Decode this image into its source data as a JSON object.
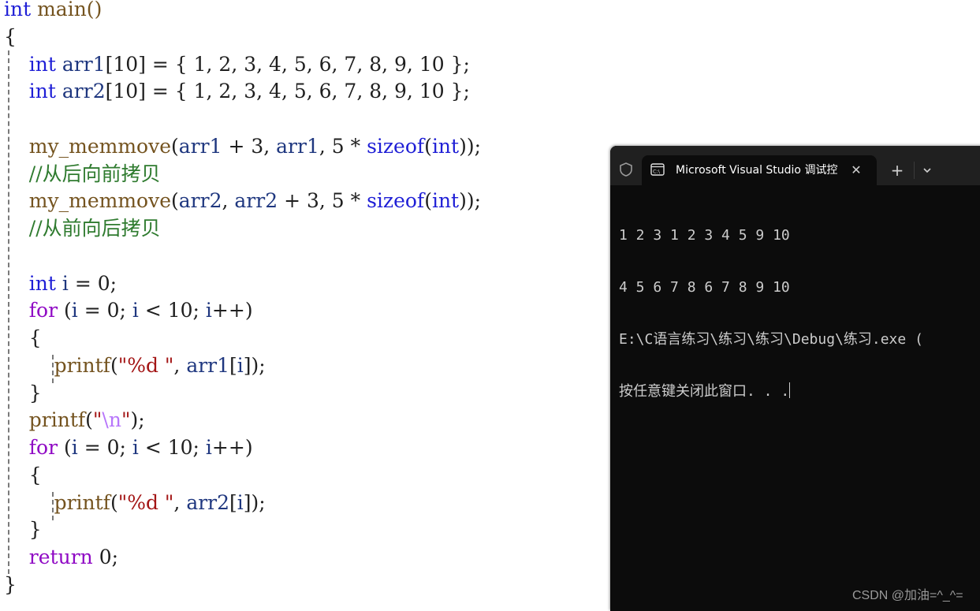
{
  "code": {
    "lines": [
      {
        "tokens": [
          {
            "t": "int",
            "c": "kw"
          },
          {
            "t": " main()",
            "c": "fn"
          }
        ]
      },
      {
        "tokens": [
          {
            "t": "{",
            "c": "punc"
          }
        ]
      },
      {
        "tokens": [
          {
            "t": "    "
          },
          {
            "t": "int",
            "c": "kw"
          },
          {
            "t": " arr1",
            "c": "var"
          },
          {
            "t": "[10] = { 1, 2, 3, 4, 5, 6, 7, 8, 9, 10 };",
            "c": "punc"
          }
        ]
      },
      {
        "tokens": [
          {
            "t": "    "
          },
          {
            "t": "int",
            "c": "kw"
          },
          {
            "t": " arr2",
            "c": "var"
          },
          {
            "t": "[10] = { 1, 2, 3, 4, 5, 6, 7, 8, 9, 10 };",
            "c": "punc"
          }
        ]
      },
      {
        "tokens": []
      },
      {
        "tokens": [
          {
            "t": "    "
          },
          {
            "t": "my_memmove",
            "c": "fn"
          },
          {
            "t": "(",
            "c": "punc"
          },
          {
            "t": "arr1",
            "c": "var"
          },
          {
            "t": " + 3, ",
            "c": "punc"
          },
          {
            "t": "arr1",
            "c": "var"
          },
          {
            "t": ", 5 * ",
            "c": "punc"
          },
          {
            "t": "sizeof",
            "c": "kw"
          },
          {
            "t": "(",
            "c": "punc"
          },
          {
            "t": "int",
            "c": "kw"
          },
          {
            "t": "));",
            "c": "punc"
          }
        ]
      },
      {
        "tokens": [
          {
            "t": "    "
          },
          {
            "t": "//从后向前拷贝",
            "c": "cmt"
          }
        ]
      },
      {
        "tokens": [
          {
            "t": "    "
          },
          {
            "t": "my_memmove",
            "c": "fn"
          },
          {
            "t": "(",
            "c": "punc"
          },
          {
            "t": "arr2",
            "c": "var"
          },
          {
            "t": ", ",
            "c": "punc"
          },
          {
            "t": "arr2",
            "c": "var"
          },
          {
            "t": " + 3, 5 * ",
            "c": "punc"
          },
          {
            "t": "sizeof",
            "c": "kw"
          },
          {
            "t": "(",
            "c": "punc"
          },
          {
            "t": "int",
            "c": "kw"
          },
          {
            "t": "));",
            "c": "punc"
          }
        ]
      },
      {
        "tokens": [
          {
            "t": "    "
          },
          {
            "t": "//从前向后拷贝",
            "c": "cmt"
          }
        ]
      },
      {
        "tokens": []
      },
      {
        "tokens": [
          {
            "t": "    "
          },
          {
            "t": "int",
            "c": "kw"
          },
          {
            "t": " i",
            "c": "var"
          },
          {
            "t": " = 0;",
            "c": "punc"
          }
        ]
      },
      {
        "tokens": [
          {
            "t": "    "
          },
          {
            "t": "for",
            "c": "ctl"
          },
          {
            "t": " (",
            "c": "punc"
          },
          {
            "t": "i",
            "c": "var"
          },
          {
            "t": " = 0; ",
            "c": "punc"
          },
          {
            "t": "i",
            "c": "var"
          },
          {
            "t": " < 10; ",
            "c": "punc"
          },
          {
            "t": "i",
            "c": "var"
          },
          {
            "t": "++)",
            "c": "punc"
          }
        ]
      },
      {
        "tokens": [
          {
            "t": "    "
          },
          {
            "t": "{",
            "c": "punc"
          }
        ]
      },
      {
        "tokens": [
          {
            "t": "        "
          },
          {
            "t": "printf",
            "c": "fn"
          },
          {
            "t": "(",
            "c": "punc"
          },
          {
            "t": "\"%d \"",
            "c": "str"
          },
          {
            "t": ", ",
            "c": "punc"
          },
          {
            "t": "arr1",
            "c": "var"
          },
          {
            "t": "[",
            "c": "punc"
          },
          {
            "t": "i",
            "c": "var"
          },
          {
            "t": "]);",
            "c": "punc"
          }
        ]
      },
      {
        "tokens": [
          {
            "t": "    "
          },
          {
            "t": "}",
            "c": "punc"
          }
        ]
      },
      {
        "tokens": [
          {
            "t": "    "
          },
          {
            "t": "printf",
            "c": "fn"
          },
          {
            "t": "(",
            "c": "punc"
          },
          {
            "t": "\"",
            "c": "str"
          },
          {
            "t": "\\n",
            "c": "esc"
          },
          {
            "t": "\"",
            "c": "str"
          },
          {
            "t": ");",
            "c": "punc"
          }
        ]
      },
      {
        "tokens": [
          {
            "t": "    "
          },
          {
            "t": "for",
            "c": "ctl"
          },
          {
            "t": " (",
            "c": "punc"
          },
          {
            "t": "i",
            "c": "var"
          },
          {
            "t": " = 0; ",
            "c": "punc"
          },
          {
            "t": "i",
            "c": "var"
          },
          {
            "t": " < 10; ",
            "c": "punc"
          },
          {
            "t": "i",
            "c": "var"
          },
          {
            "t": "++)",
            "c": "punc"
          }
        ]
      },
      {
        "tokens": [
          {
            "t": "    "
          },
          {
            "t": "{",
            "c": "punc"
          }
        ]
      },
      {
        "tokens": [
          {
            "t": "        "
          },
          {
            "t": "printf",
            "c": "fn"
          },
          {
            "t": "(",
            "c": "punc"
          },
          {
            "t": "\"%d \"",
            "c": "str"
          },
          {
            "t": ", ",
            "c": "punc"
          },
          {
            "t": "arr2",
            "c": "var"
          },
          {
            "t": "[",
            "c": "punc"
          },
          {
            "t": "i",
            "c": "var"
          },
          {
            "t": "]);",
            "c": "punc"
          }
        ]
      },
      {
        "tokens": [
          {
            "t": "    "
          },
          {
            "t": "}",
            "c": "punc"
          }
        ]
      },
      {
        "tokens": [
          {
            "t": "    "
          },
          {
            "t": "return",
            "c": "ctl"
          },
          {
            "t": " 0;",
            "c": "punc"
          }
        ]
      },
      {
        "tokens": [
          {
            "t": "}",
            "c": "punc"
          }
        ]
      }
    ]
  },
  "terminal": {
    "tab_title": "Microsoft Visual Studio 调试控制台",
    "tab_icon": "console-icon",
    "shield_icon": "shield-icon",
    "close_glyph": "✕",
    "new_tab_glyph": "+",
    "output_lines": [
      "1 2 3 1 2 3 4 5 9 10",
      "4 5 6 7 8 6 7 8 9 10",
      "E:\\C语言练习\\练习\\练习\\Debug\\练习.exe (",
      "按任意键关闭此窗口. . ."
    ]
  },
  "watermark": "CSDN @加油=^_^="
}
